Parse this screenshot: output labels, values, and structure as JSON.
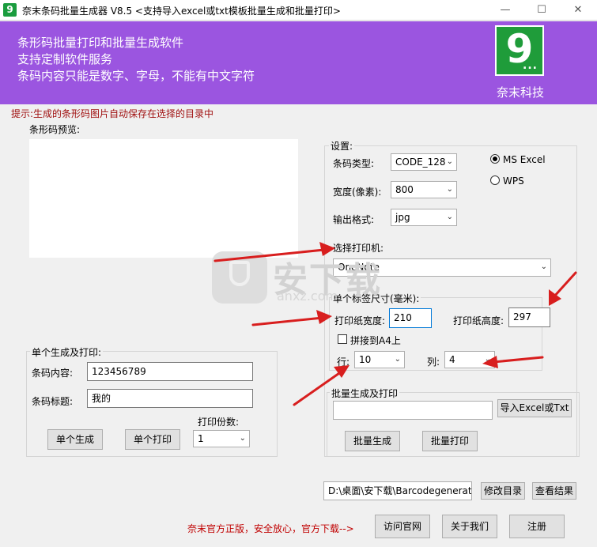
{
  "window": {
    "title": "奈末条码批量生成器 V8.5    <支持导入excel或txt模板批量生成和批量打印>",
    "icon_glyph": "9",
    "buttons": [
      "minimize-icon",
      "maximize-icon",
      "close-icon"
    ]
  },
  "banner": {
    "lines": [
      "条形码批量打印和批量生成软件",
      "支持定制软件服务",
      "条码内容只能是数字、字母，不能有中文字符"
    ],
    "logo_text": "9",
    "logo_dots": "...",
    "company": "奈末科技",
    "background": "#9b55e0",
    "logo_color": "#1f9c3a"
  },
  "hint": "提示:生成的条形码图片自动保存在选择的目录中",
  "preview": {
    "label": "条形码预览:"
  },
  "settings": {
    "title": "设置:",
    "barcode_type_label": "条码类型:",
    "barcode_type_value": "CODE_128",
    "width_label": "宽度(像素):",
    "width_value": "800",
    "format_label": "输出格式:",
    "format_value": "jpg",
    "radio_excel": "MS  Excel",
    "radio_wps": "WPS",
    "selected_office": "MS Excel"
  },
  "printer": {
    "title": "选择打印机:",
    "value": "OneNote"
  },
  "label_size": {
    "title": "单个标签尺寸(毫米):",
    "paper_width_label": "打印纸宽度:",
    "paper_width_value": "210",
    "paper_height_label": "打印纸高度:",
    "paper_height_value": "297",
    "a4_label": "拼接到A4上",
    "a4_checked": false,
    "rows_label": "行:",
    "rows_value": "10",
    "cols_label": "列:",
    "cols_value": "4"
  },
  "single": {
    "title": "单个生成及打印:",
    "content_label": "条码内容:",
    "content_value": "123456789",
    "caption_label": "条码标题:",
    "caption_value": "我的",
    "copies_label": "打印份数:",
    "copies_value": "1",
    "generate_button": "单个生成",
    "print_button": "单个打印"
  },
  "batch": {
    "title": "批量生成及打印",
    "file_value": "",
    "import_button": "导入Excel或Txt",
    "generate_button": "批量生成",
    "print_button": "批量打印"
  },
  "directory": {
    "path_value": "D:\\桌面\\安下载\\Barcodegenerato",
    "change_button": "修改目录",
    "view_button": "查看结果"
  },
  "footer": {
    "note": "奈末官方正版，安全放心，官方下载-->",
    "website_button": "访问官网",
    "about_button": "关于我们",
    "register_button": "注册"
  },
  "watermark": {
    "text": "安下载",
    "url": "anxz.com"
  },
  "annotation_color": "#d81e1e"
}
